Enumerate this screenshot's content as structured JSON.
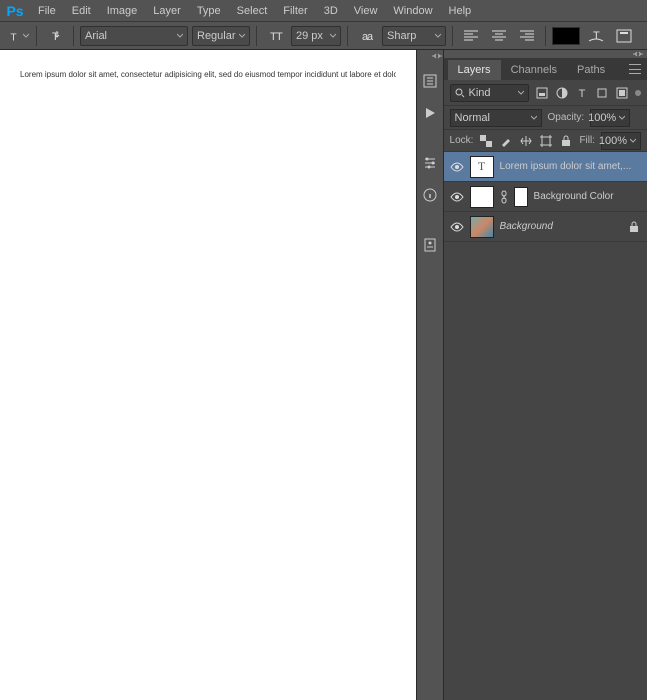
{
  "menubar": [
    "File",
    "Edit",
    "Image",
    "Layer",
    "Type",
    "Select",
    "Filter",
    "3D",
    "View",
    "Window",
    "Help"
  ],
  "options": {
    "font": "Arial",
    "weight": "Regular",
    "size": "29 px",
    "antialias": "Sharp"
  },
  "canvas": {
    "text": "Lorem ipsum dolor sit amet, consectetur adipisicing elit, sed do eiusmod tempor incididunt ut labore et dolore magna aliqua. Ut enim ad minim veniam, quis no"
  },
  "panels": {
    "tabs": [
      "Layers",
      "Channels",
      "Paths"
    ],
    "activeTab": 0,
    "filter": {
      "kind": "Kind"
    },
    "blend": {
      "mode": "Normal",
      "opacityLabel": "Opacity:",
      "opacity": "100%",
      "fillLabel": "Fill:",
      "fill": "100%"
    },
    "lockLabel": "Lock:",
    "layers": [
      {
        "name": "Lorem ipsum dolor sit amet,...",
        "type": "text",
        "visible": true,
        "selected": true,
        "locked": false
      },
      {
        "name": "Background Color",
        "type": "fill",
        "visible": true,
        "selected": false,
        "locked": false
      },
      {
        "name": "Background",
        "type": "image",
        "visible": true,
        "selected": false,
        "locked": true,
        "italic": true
      }
    ]
  }
}
